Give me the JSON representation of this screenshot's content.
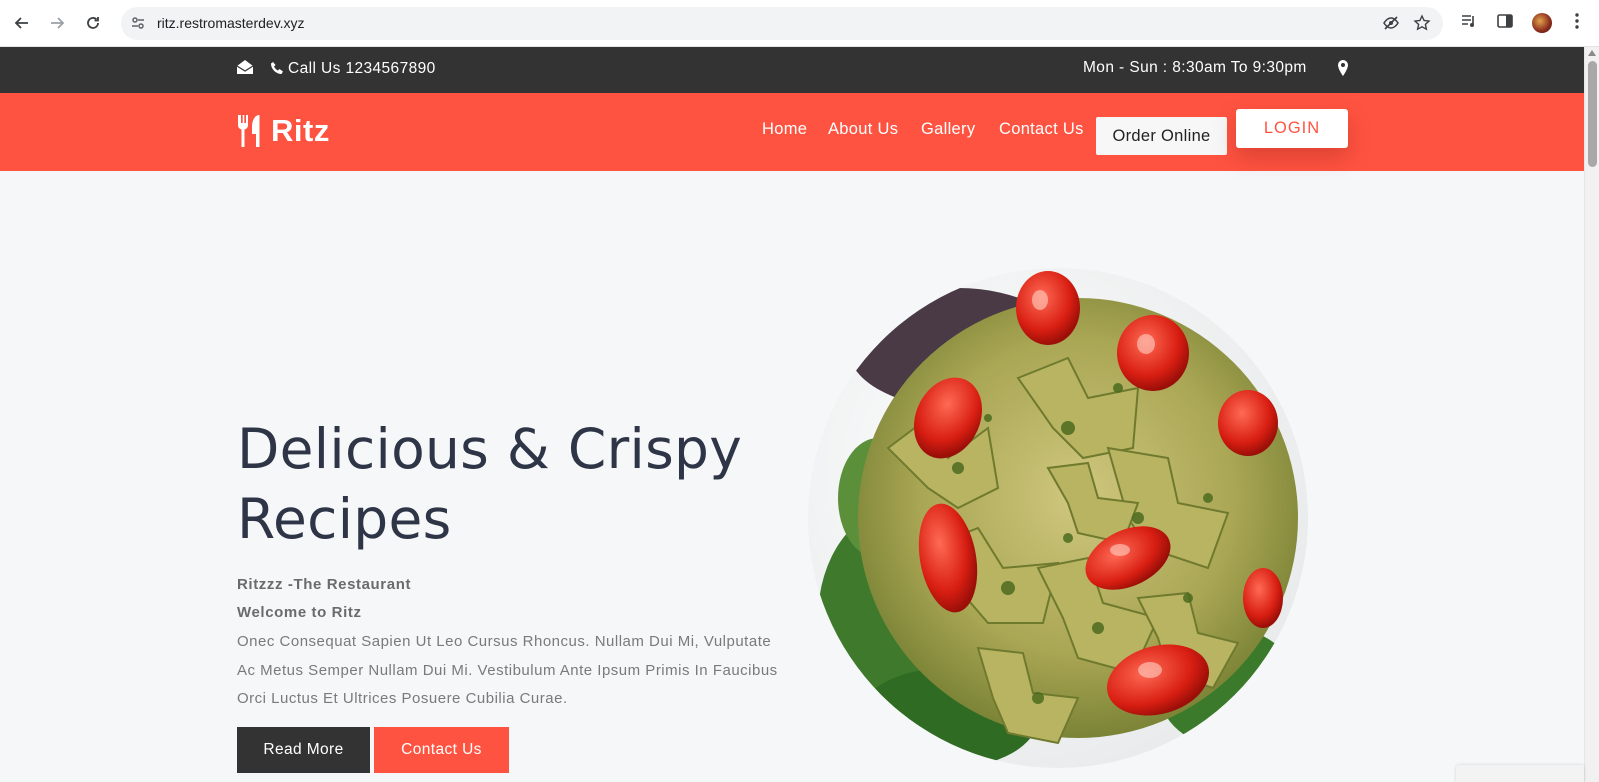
{
  "browser": {
    "url": "ritz.restromasterdev.xyz",
    "icons": {
      "back": "back-arrow-icon",
      "forward": "forward-arrow-icon",
      "reload": "reload-icon",
      "site_info": "site-settings-icon",
      "tracking": "eye-off-icon",
      "bookmark": "star-icon",
      "media": "media-queue-icon",
      "sidepanel": "side-panel-icon",
      "menu": "kebab-menu-icon"
    }
  },
  "topbar": {
    "call_text": "Call Us 1234567890",
    "hours_text": "Mon - Sun : 8:30am To 9:30pm"
  },
  "navbar": {
    "brand": "Ritz",
    "links": [
      "Home",
      "About Us",
      "Gallery",
      "Contact Us"
    ],
    "order_button": "Order Online",
    "login_button": "LOGIN"
  },
  "hero": {
    "title_line1": "Delicious & Crispy",
    "title_line2": "Recipes",
    "tagline": "Ritzzz -The Restaurant",
    "welcome": "Welcome to  Ritz",
    "description": "Onec Consequat Sapien Ut Leo Cursus Rhoncus. Nullam Dui Mi, Vulputate Ac Metus Semper Nullam Dui Mi. Vestibulum Ante Ipsum Primis In Faucibus Orci Luctus Et Ultrices Posuere Cubilia Curae.",
    "read_more_button": "Read More",
    "contact_button": "Contact Us"
  },
  "colors": {
    "brand_red": "#ff5341",
    "dark_bar": "#333333",
    "page_bg": "#f6f7f9",
    "heading": "#2e3547"
  }
}
